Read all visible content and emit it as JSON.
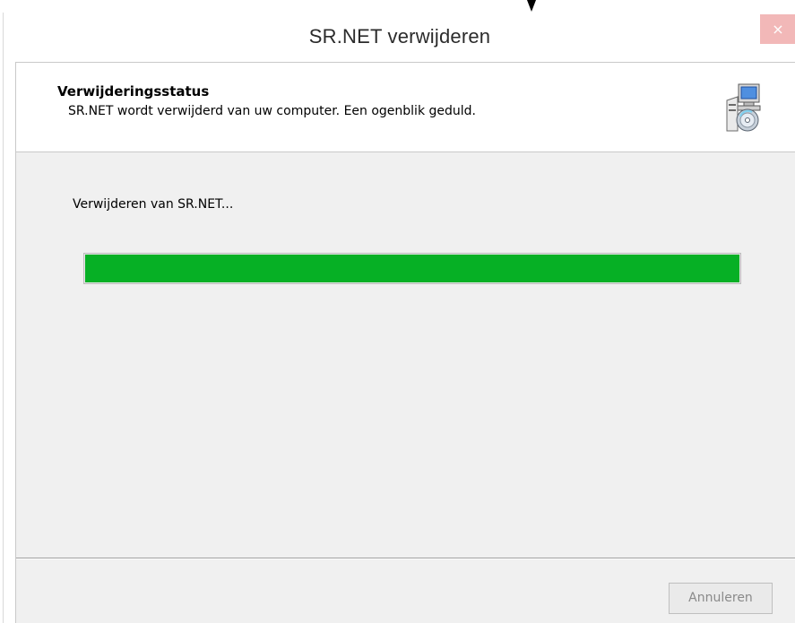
{
  "window": {
    "title": "SR.NET verwijderen",
    "close_symbol": "×",
    "close_color": "#f2b8b8"
  },
  "header": {
    "title": "Verwijderingsstatus",
    "subtitle": "SR.NET wordt verwijderd van uw computer. Een ogenblik geduld.",
    "icon": "installer-computer-disc-icon"
  },
  "main": {
    "status_text": "Verwijderen van SR.NET...",
    "progress_fraction": 1.0,
    "progress_color": "#06b025"
  },
  "footer": {
    "cancel_label": "Annuleren",
    "cancel_enabled": false
  }
}
